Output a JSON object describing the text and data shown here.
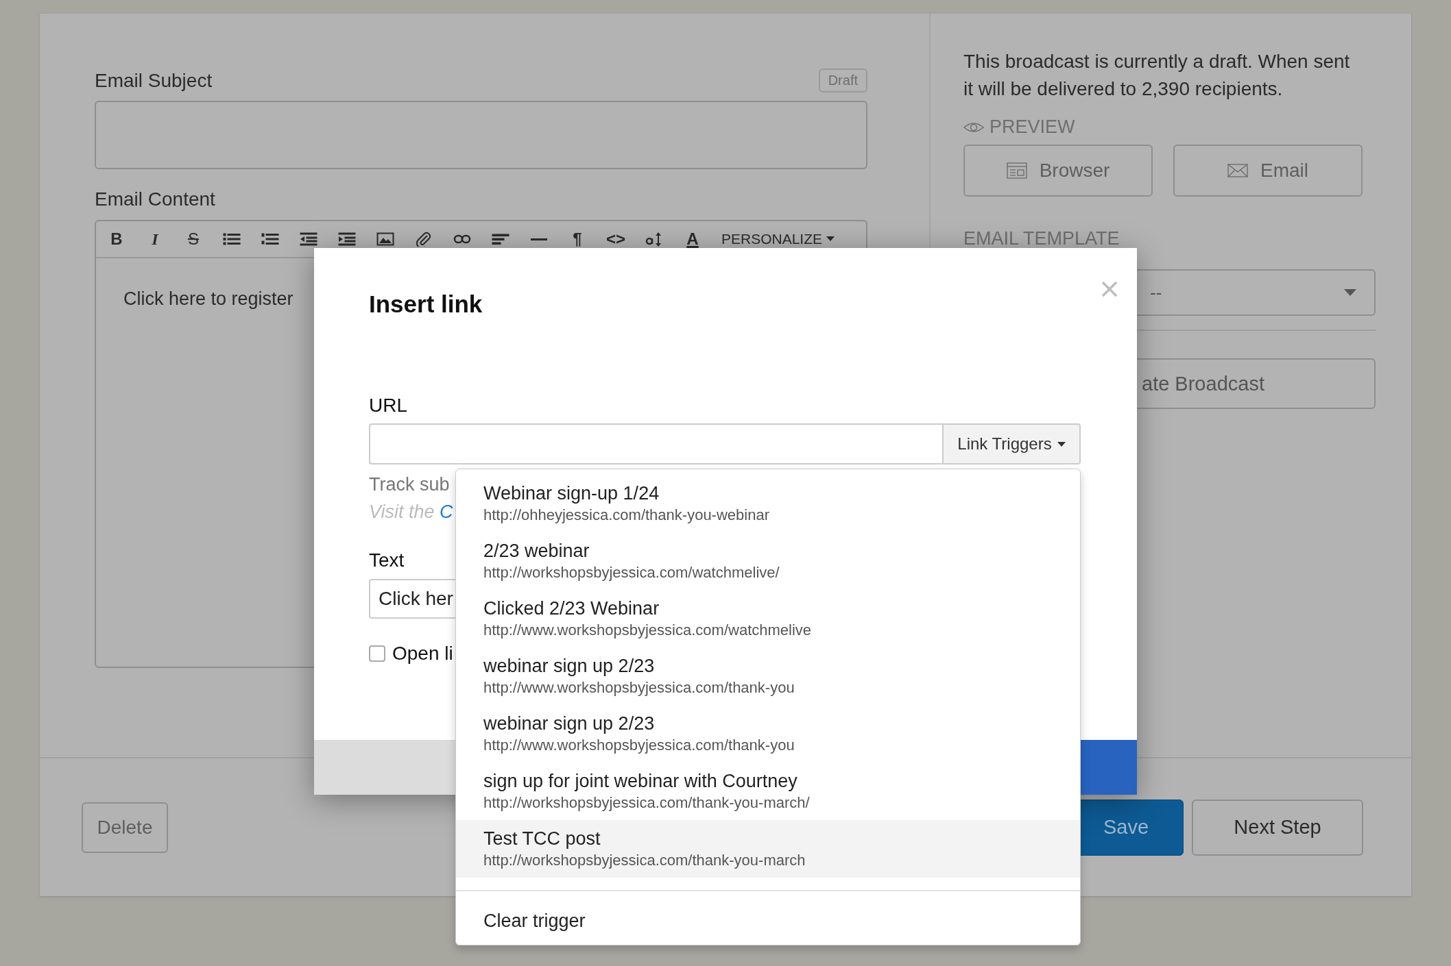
{
  "editor": {
    "subject_label": "Email Subject",
    "status_badge": "Draft",
    "content_label": "Email Content",
    "toolbar": [
      {
        "kind": "bold",
        "label": "B"
      },
      {
        "kind": "italic",
        "label": "I"
      },
      {
        "kind": "strike",
        "label": "S"
      },
      {
        "kind": "bullets"
      },
      {
        "kind": "numbers"
      },
      {
        "kind": "outdent"
      },
      {
        "kind": "indent"
      },
      {
        "kind": "image"
      },
      {
        "kind": "attach"
      },
      {
        "kind": "link"
      },
      {
        "kind": "align"
      },
      {
        "kind": "rule"
      },
      {
        "kind": "bold",
        "label": "¶"
      },
      {
        "kind": "plain",
        "label": "<>"
      },
      {
        "kind": "textsize"
      },
      {
        "kind": "underline",
        "label": "A"
      }
    ],
    "personalize": "PERSONALIZE",
    "content": "Click here to register"
  },
  "sidebar": {
    "info": "This broadcast is currently a draft. When sent it will be delivered to 2,390 recipients.",
    "preview_label": "PREVIEW",
    "preview_buttons": [
      {
        "label": "Browser",
        "kind": "browser"
      },
      {
        "label": "Email",
        "kind": "envelope"
      }
    ],
    "template_label": "EMAIL TEMPLATE",
    "template_value": "--",
    "action_button": "ate Broadcast"
  },
  "footer": {
    "delete": "Delete",
    "save": "Save",
    "next": "Next Step"
  },
  "dialog": {
    "title": "Insert link",
    "url_label": "URL",
    "triggers_button": "Link Triggers",
    "help": "Track sub",
    "help2_prefix": "Visit the ",
    "help2_link": "C",
    "text_label": "Text",
    "text_value": "Click her",
    "new_tab_label": "Open li",
    "new_tab_checked": false
  },
  "trigger_menu": {
    "items": [
      {
        "name": "Webinar sign-up 1/24",
        "url": "http://ohheyjessica.com/thank-you-webinar",
        "selected": false
      },
      {
        "name": "2/23 webinar",
        "url": "http://workshopsbyjessica.com/watchmelive/",
        "selected": false
      },
      {
        "name": "Clicked 2/23 Webinar",
        "url": "http://www.workshopsbyjessica.com/watchmelive",
        "selected": false
      },
      {
        "name": "webinar sign up 2/23",
        "url": "http://www.workshopsbyjessica.com/thank-you",
        "selected": false
      },
      {
        "name": "webinar sign up 2/23",
        "url": "http://www.workshopsbyjessica.com/thank-you",
        "selected": false
      },
      {
        "name": "sign up for joint webinar with Courtney",
        "url": "http://workshopsbyjessica.com/thank-you-march/",
        "selected": false
      },
      {
        "name": "Test TCC post",
        "url": "http://workshopsbyjessica.com/thank-you-march",
        "selected": true
      }
    ],
    "clear": "Clear trigger"
  }
}
